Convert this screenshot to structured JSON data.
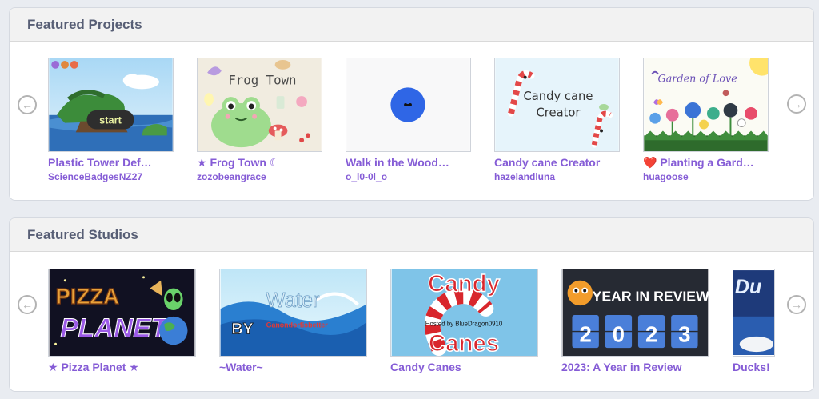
{
  "featured_projects": {
    "title": "Featured Projects",
    "prev_icon": "arrow-left-circle-icon",
    "next_icon": "arrow-right-circle-icon",
    "items": [
      {
        "title": "Plastic Tower Def…",
        "owner": "ScienceBadgesNZ27",
        "thumb_text": "start"
      },
      {
        "title": "★ Frog Town ☾",
        "owner": "zozobeangrace",
        "thumb_text": "Frog Town"
      },
      {
        "title": "Walk in the Wood…",
        "owner": "o_l0-0l_o"
      },
      {
        "title": "Candy cane Creator",
        "owner": "hazelandluna",
        "thumb_text_line1": "Candy cane",
        "thumb_text_line2": "Creator"
      },
      {
        "title": "❤️ Planting a Gard…",
        "owner": "huagoose",
        "thumb_text": "Garden of Love"
      }
    ]
  },
  "featured_studios": {
    "title": "Featured Studios",
    "prev_icon": "arrow-left-circle-icon",
    "next_icon": "arrow-right-circle-icon",
    "items": [
      {
        "title": "★ Pizza Planet ★",
        "thumb_text_line1": "PIZZA",
        "thumb_text_line2": "PLANET"
      },
      {
        "title": "~Water~",
        "thumb_text": "Water",
        "thumb_text_by": "BY",
        "thumb_text_author": "Ganondorfisbetter"
      },
      {
        "title": "Candy Canes",
        "thumb_text_line1": "Candy",
        "thumb_text_line2": "Canes",
        "thumb_text_host": "Hosted by BlueDragon0910"
      },
      {
        "title": "2023: A Year in Review",
        "thumb_text": "YEAR IN REVIEW",
        "thumb_digits": [
          "2",
          "0",
          "2",
          "3"
        ]
      },
      {
        "title": "Ducks!",
        "thumb_text": "Du"
      }
    ]
  }
}
